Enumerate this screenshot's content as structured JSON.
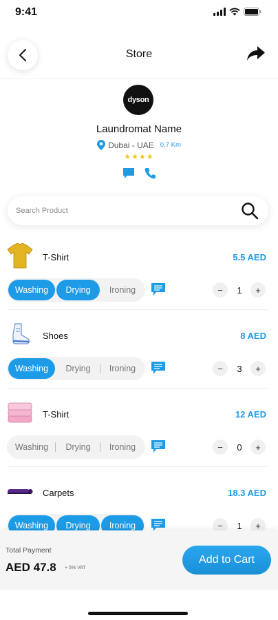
{
  "status_bar": {
    "time": "9:41"
  },
  "header": {
    "title": "Store"
  },
  "store": {
    "logo_text": "dyson",
    "name": "Laundromat Name",
    "location": "Dubai - UAE",
    "distance": "0.7 Km",
    "rating_stars": "★★★★"
  },
  "search": {
    "placeholder": "Search Product"
  },
  "service_labels": {
    "washing": "Washing",
    "drying": "Drying",
    "ironing": "Ironing"
  },
  "products": [
    {
      "name": "T-Shirt",
      "price": "5.5 AED",
      "quantity": "1",
      "washing": true,
      "drying": true,
      "ironing": false
    },
    {
      "name": "Shoes",
      "price": "8 AED",
      "quantity": "3",
      "washing": true,
      "drying": false,
      "ironing": false
    },
    {
      "name": "T-Shirt",
      "price": "12 AED",
      "quantity": "0",
      "washing": false,
      "drying": false,
      "ironing": false
    },
    {
      "name": "Carpets",
      "price": "18.3 AED",
      "quantity": "1",
      "washing": true,
      "drying": true,
      "ironing": true
    }
  ],
  "qty_controls": {
    "minus": "−",
    "plus": "+"
  },
  "footer": {
    "total_label": "Total Payment",
    "total_amount": "AED 47.8",
    "vat_note": "+ 5% VAT",
    "add_to_cart": "Add to Cart"
  },
  "colors": {
    "accent": "#1e9be6",
    "star": "#f5c518"
  }
}
